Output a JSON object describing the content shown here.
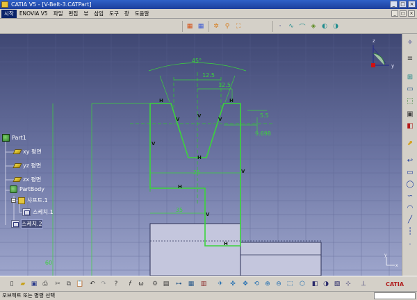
{
  "window": {
    "title": "CATIA V5 - [V-Belt-3.CATPart]"
  },
  "menu": [
    "시작",
    "ENOVIA V5",
    "파일",
    "편집",
    "뷰",
    "삽입",
    "도구",
    "창",
    "도움말"
  ],
  "tree": {
    "part": "Part1",
    "planes": [
      "xy 평면",
      "yz 평면",
      "zx 평면"
    ],
    "body": "PartBody",
    "shaft": "샤프트.1",
    "sketch1": "스케치.1",
    "sketch2": "스케치.2"
  },
  "sketch": {
    "dims": {
      "angle": "45°",
      "top_width": "12.5",
      "half_width": "12.5",
      "depth": "5.5",
      "dia": "9.698",
      "bottom_width": "25",
      "step": "35",
      "height": "60"
    },
    "constraint_letters": {
      "h": "H",
      "v": "V"
    }
  },
  "axis": {
    "x": "x",
    "y": "y",
    "z": "z"
  },
  "status": {
    "text": "오브젝트 또는 명령 선택"
  },
  "colors": {
    "sketch": "#3bd43b",
    "bg_top": "#3f4773",
    "bg_bottom": "#9ea6cc",
    "selected_tree": "#444c78"
  },
  "icons": {
    "top_toolbar": [
      "grid-icon",
      "snap-grid-icon",
      "construction-icon",
      "geometric-constraint-icon",
      "dimensional-constraint-icon",
      "point-icon",
      "line-icon",
      "spline-icon",
      "exit-workbench-icon",
      "sketch-analysis-icon"
    ],
    "right_toolbar": [
      "sketch-icon",
      "positioned-sketch-icon",
      "exit-sketch-icon",
      "profile-icon",
      "rectangle-icon",
      "circle-icon",
      "spline-icon",
      "conic-icon",
      "line-icon",
      "axis-icon",
      "point-icon"
    ],
    "bottom_toolbar": [
      "new-icon",
      "open-icon",
      "save-icon",
      "print-icon",
      "cut-icon",
      "copy-icon",
      "paste-icon",
      "undo-icon",
      "redo-icon",
      "whats-this-icon",
      "formula-icon",
      "law-icon",
      "catalog-icon",
      "fly-icon",
      "fit-all-icon",
      "pan-icon",
      "rotate-icon",
      "zoom-in-icon",
      "zoom-out-icon",
      "normal-view-icon",
      "iso-view-icon",
      "shading-icon",
      "hide-show-icon",
      "swap-space-icon",
      "axis-system-icon",
      "catia-logo"
    ]
  }
}
